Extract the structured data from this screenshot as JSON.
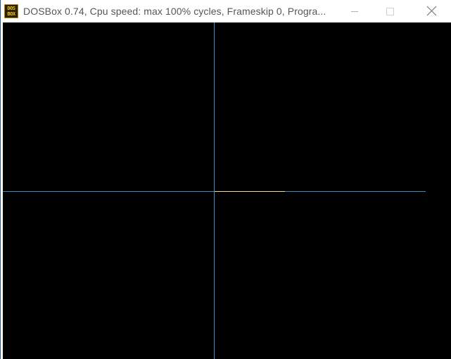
{
  "window": {
    "title": "DOSBox 0.74, Cpu speed: max 100% cycles, Frameskip  0, Progra...",
    "icon_text_top": "DOS",
    "icon_text_bottom": "BOX",
    "icon": "dosbox-app-icon",
    "buttons": {
      "minimize": "minimize-icon",
      "maximize": "maximize-icon",
      "close": "close-icon"
    }
  },
  "screen": {
    "background": "#000000",
    "axis_color": "#3a8fbf",
    "trace_color": "#f2e08a"
  }
}
